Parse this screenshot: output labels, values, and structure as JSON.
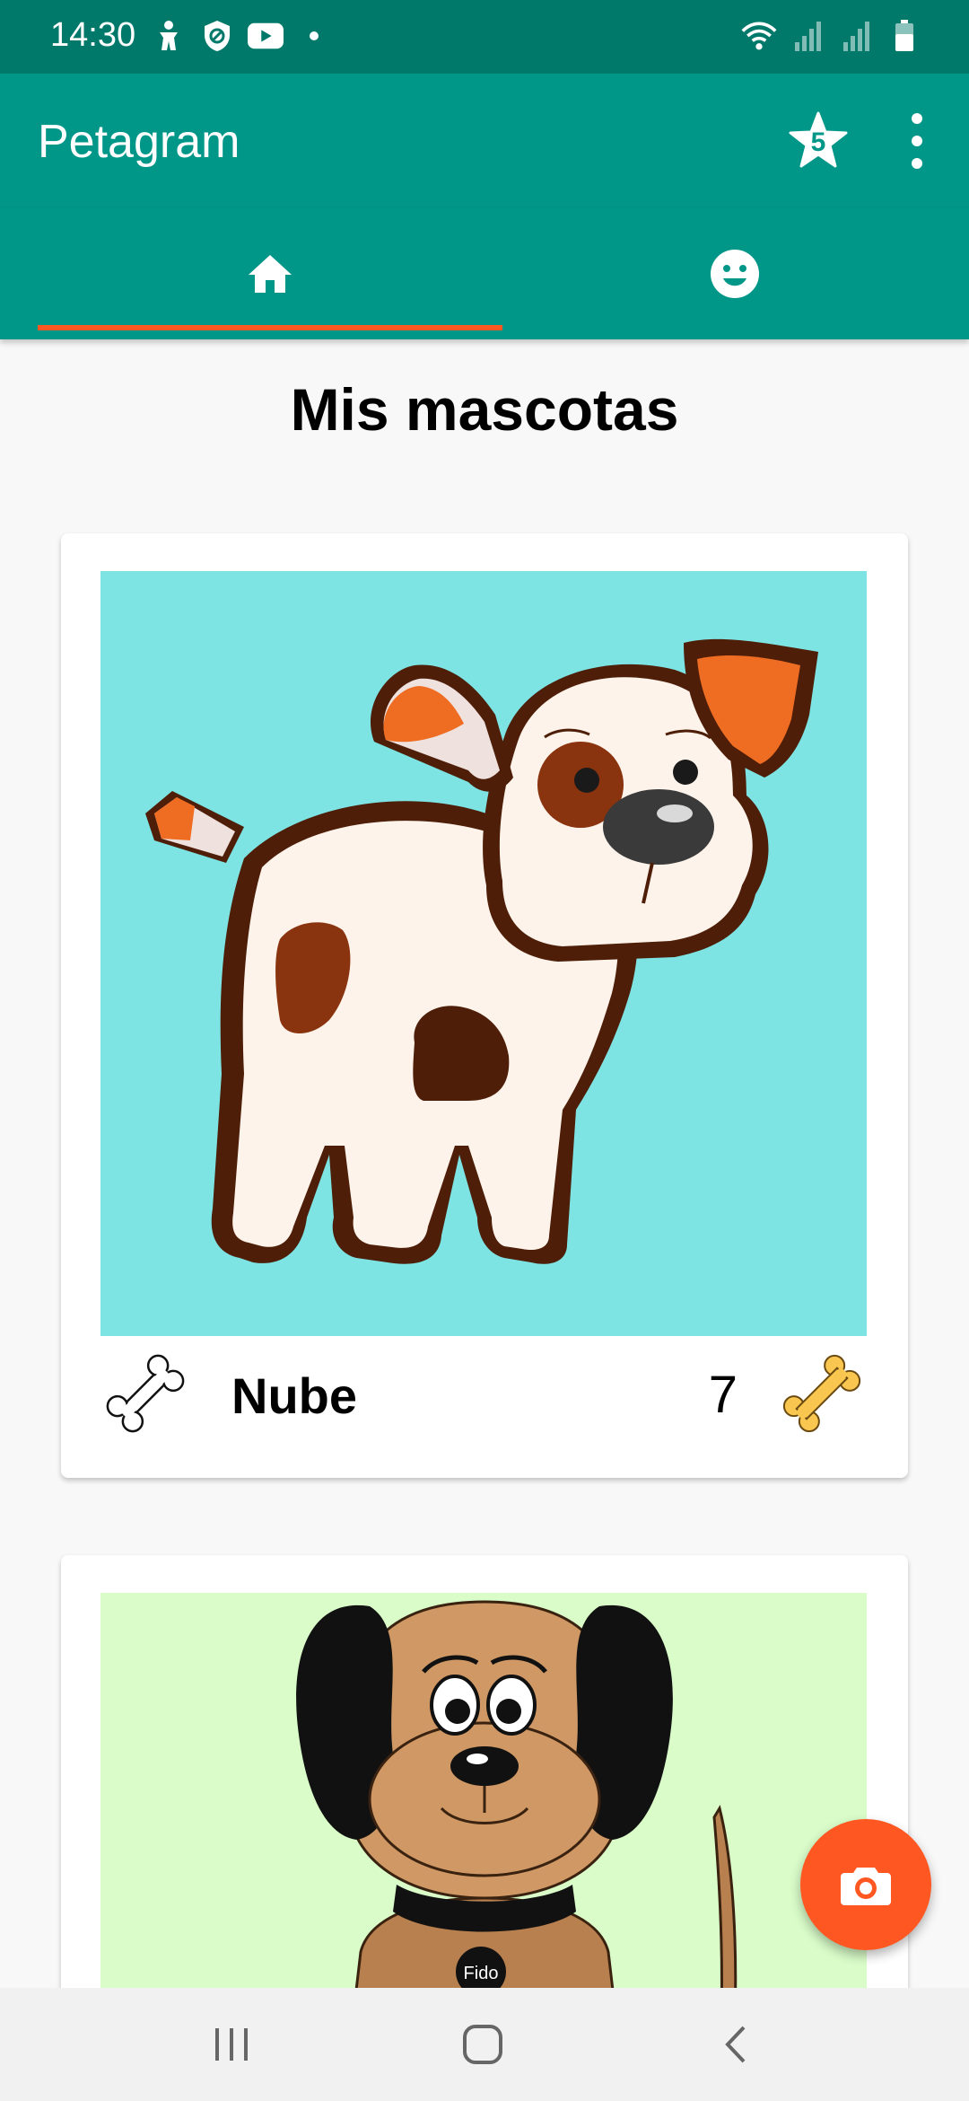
{
  "status_bar": {
    "time": "14:30"
  },
  "app_bar": {
    "title": "Petagram",
    "favorites_count": "5"
  },
  "tabs": [
    {
      "icon": "home-icon",
      "selected": true
    },
    {
      "icon": "smiley-icon",
      "selected": false
    }
  ],
  "main": {
    "title": "Mis mascotas",
    "pets": [
      {
        "name": "Nube",
        "likes": "7"
      },
      {
        "collar_tag": "Fido"
      }
    ]
  },
  "colors": {
    "status_bar": "#00796b",
    "primary": "#009688",
    "accent": "#ff5722",
    "card_1_bg": "#7de3e3",
    "card_2_bg": "#d9fcc9"
  }
}
